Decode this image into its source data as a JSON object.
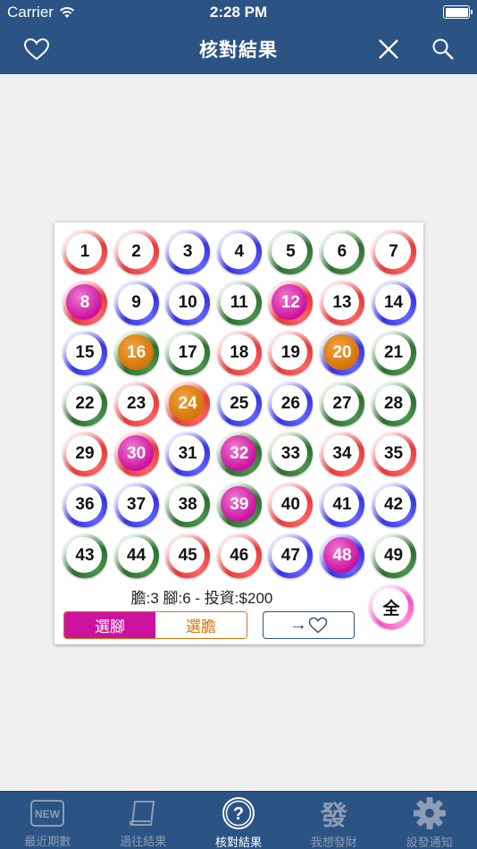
{
  "status": {
    "carrier": "Carrier",
    "time": "2:28 PM"
  },
  "nav": {
    "title": "核對結果"
  },
  "balls": [
    {
      "n": "1",
      "c": "red"
    },
    {
      "n": "2",
      "c": "red"
    },
    {
      "n": "3",
      "c": "blue"
    },
    {
      "n": "4",
      "c": "blue"
    },
    {
      "n": "5",
      "c": "green"
    },
    {
      "n": "6",
      "c": "green"
    },
    {
      "n": "7",
      "c": "red"
    },
    {
      "n": "8",
      "c": "red",
      "s": "leg"
    },
    {
      "n": "9",
      "c": "blue"
    },
    {
      "n": "10",
      "c": "blue"
    },
    {
      "n": "11",
      "c": "green"
    },
    {
      "n": "12",
      "c": "red",
      "s": "leg"
    },
    {
      "n": "13",
      "c": "red"
    },
    {
      "n": "14",
      "c": "blue"
    },
    {
      "n": "15",
      "c": "blue"
    },
    {
      "n": "16",
      "c": "green",
      "s": "banker"
    },
    {
      "n": "17",
      "c": "green"
    },
    {
      "n": "18",
      "c": "red"
    },
    {
      "n": "19",
      "c": "red"
    },
    {
      "n": "20",
      "c": "blue",
      "s": "banker"
    },
    {
      "n": "21",
      "c": "green"
    },
    {
      "n": "22",
      "c": "green"
    },
    {
      "n": "23",
      "c": "red"
    },
    {
      "n": "24",
      "c": "red",
      "s": "banker"
    },
    {
      "n": "25",
      "c": "blue"
    },
    {
      "n": "26",
      "c": "blue"
    },
    {
      "n": "27",
      "c": "green"
    },
    {
      "n": "28",
      "c": "green"
    },
    {
      "n": "29",
      "c": "red"
    },
    {
      "n": "30",
      "c": "red",
      "s": "leg"
    },
    {
      "n": "31",
      "c": "blue"
    },
    {
      "n": "32",
      "c": "green",
      "s": "leg"
    },
    {
      "n": "33",
      "c": "green"
    },
    {
      "n": "34",
      "c": "red"
    },
    {
      "n": "35",
      "c": "red"
    },
    {
      "n": "36",
      "c": "blue"
    },
    {
      "n": "37",
      "c": "blue"
    },
    {
      "n": "38",
      "c": "green"
    },
    {
      "n": "39",
      "c": "green",
      "s": "leg"
    },
    {
      "n": "40",
      "c": "red"
    },
    {
      "n": "41",
      "c": "blue"
    },
    {
      "n": "42",
      "c": "blue"
    },
    {
      "n": "43",
      "c": "green"
    },
    {
      "n": "44",
      "c": "green"
    },
    {
      "n": "45",
      "c": "red"
    },
    {
      "n": "46",
      "c": "red"
    },
    {
      "n": "47",
      "c": "blue"
    },
    {
      "n": "48",
      "c": "blue",
      "s": "leg"
    },
    {
      "n": "49",
      "c": "green"
    }
  ],
  "summary": "膽:3 腳:6 - 投資:$200",
  "all_label": "全",
  "segment": {
    "legs": "選腳",
    "banker": "選膽"
  },
  "fav_button": {
    "arrow": "→"
  },
  "tabs": [
    {
      "label": "最近期數",
      "icon": "new-icon"
    },
    {
      "label": "過往結果",
      "icon": "scroll-icon"
    },
    {
      "label": "核對結果",
      "icon": "question-icon",
      "active": true
    },
    {
      "label": "我想發財",
      "icon": "fa-tile-icon",
      "glyph": "發"
    },
    {
      "label": "設發通知",
      "icon": "gear-icon"
    }
  ],
  "colors": {
    "primary": "#2b5384",
    "leg": "#cc119f",
    "banker": "#d37408"
  }
}
